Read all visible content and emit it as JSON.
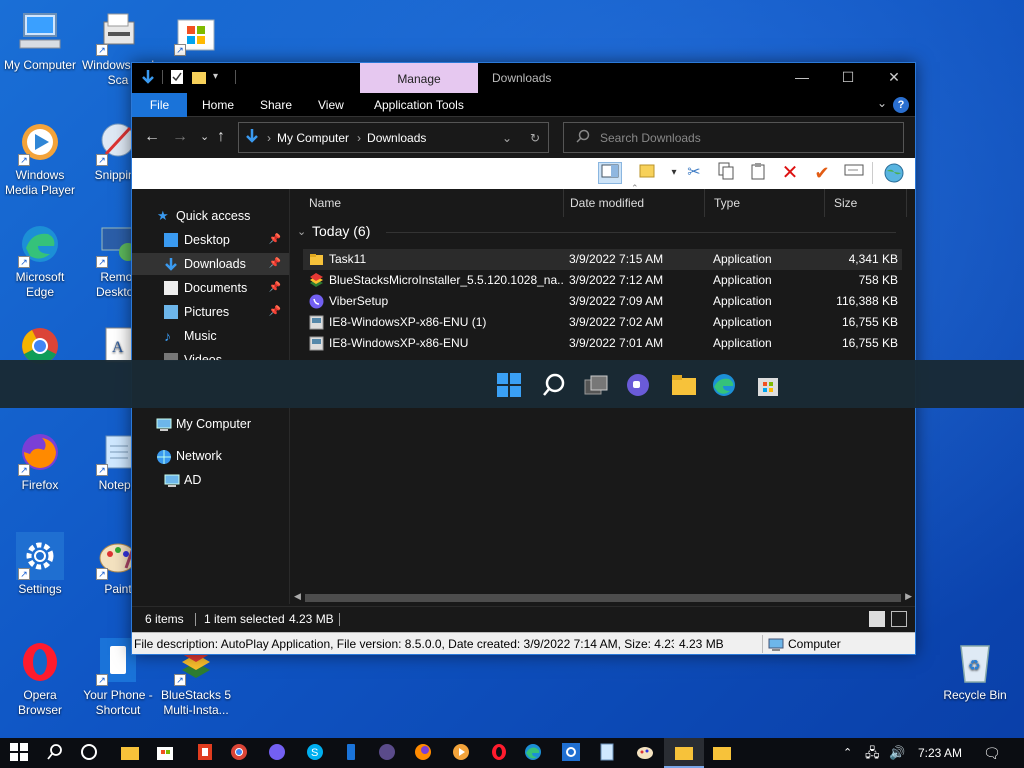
{
  "desktop": {
    "icons": [
      {
        "label": "My Computer",
        "icon": "computer-icon"
      },
      {
        "label": "Windows and Sca",
        "icon": "fax-scanner-icon"
      },
      {
        "label": "",
        "icon": "store-icon"
      },
      {
        "label": "Windows Media Player",
        "icon": "media-player-icon"
      },
      {
        "label": "Snipping",
        "icon": "snipping-icon"
      },
      {
        "label": "Microsoft Edge",
        "icon": "edge-icon"
      },
      {
        "label": "Remot Desktop",
        "icon": "remote-desktop-icon"
      },
      {
        "label": "Firefox",
        "icon": "firefox-icon"
      },
      {
        "label": "Notepa",
        "icon": "notepad-icon"
      },
      {
        "label": "Settings",
        "icon": "settings-icon"
      },
      {
        "label": "Paint",
        "icon": "paint-icon"
      },
      {
        "label": "Opera Browser",
        "icon": "opera-icon"
      },
      {
        "label": "Your Phone - Shortcut",
        "icon": "your-phone-icon"
      },
      {
        "label": "BlueStacks 5 Multi-Insta...",
        "icon": "bluestacks-icon"
      },
      {
        "label": "Recycle Bin",
        "icon": "recycle-bin-icon"
      }
    ]
  },
  "window": {
    "manage_tab": "Manage",
    "title": "Downloads",
    "ribbon_tabs": [
      "File",
      "Home",
      "Share",
      "View",
      "Application Tools"
    ],
    "address": {
      "root": "My Computer",
      "current": "Downloads"
    },
    "search_placeholder": "Search Downloads",
    "nav": {
      "quick_access": "Quick access",
      "items": [
        {
          "label": "Desktop",
          "pinned": true
        },
        {
          "label": "Downloads",
          "pinned": true
        },
        {
          "label": "Documents",
          "pinned": true
        },
        {
          "label": "Pictures",
          "pinned": true
        },
        {
          "label": "Music",
          "pinned": false
        },
        {
          "label": "Videos",
          "pinned": false
        }
      ],
      "my_computer": "My Computer",
      "network": "Network",
      "ad": "AD"
    },
    "columns": [
      "Name",
      "Date modified",
      "Type",
      "Size"
    ],
    "group": "Today (6)",
    "rows": [
      {
        "name": "Task11",
        "date": "3/9/2022 7:15 AM",
        "type": "Application",
        "size": "4,341 KB"
      },
      {
        "name": "BlueStacksMicroInstaller_5.5.120.1028_na...",
        "date": "3/9/2022 7:12 AM",
        "type": "Application",
        "size": "758 KB"
      },
      {
        "name": "ViberSetup",
        "date": "3/9/2022 7:09 AM",
        "type": "Application",
        "size": "116,388 KB"
      },
      {
        "name": "IE8-WindowsXP-x86-ENU (1)",
        "date": "3/9/2022 7:02 AM",
        "type": "Application",
        "size": "16,755 KB"
      },
      {
        "name": "IE8-WindowsXP-x86-ENU",
        "date": "3/9/2022 7:01 AM",
        "type": "Application",
        "size": "16,755 KB"
      }
    ],
    "status": {
      "items": "6 items",
      "selected": "1 item selected",
      "selected_size": "4.23 MB"
    },
    "details": {
      "text": "File description: AutoPlay Application, File version: 8.5.0.0, Date created: 3/9/2022 7:14 AM, Size: 4.23 ME",
      "size": "4.23 MB",
      "location": "Computer"
    }
  },
  "taskbar": {
    "time": "7:23 AM"
  },
  "colors": {
    "accent": "#1a73d9",
    "manage": "#e6c8f0",
    "window_bg": "#191919"
  }
}
